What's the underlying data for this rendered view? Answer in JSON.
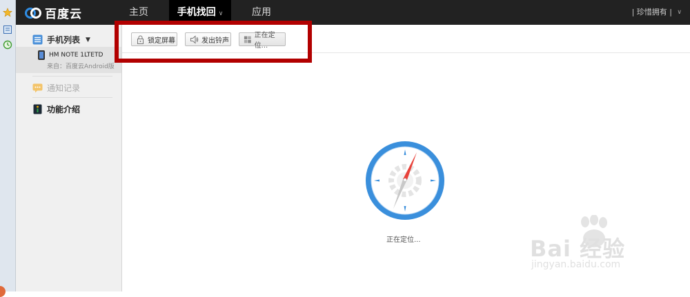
{
  "app": {
    "brand": "百度云"
  },
  "nav": {
    "home": "主页",
    "find_phone": "手机找回",
    "apps": "应用"
  },
  "user": {
    "name": "| 珍惜拥有 |"
  },
  "sidebar": {
    "phone_list": "手机列表",
    "device": {
      "name": "HM NOTE 1LTETD",
      "source": "来自：百度云Android版"
    },
    "notify_log": "通知记录",
    "feature_intro": "功能介绍"
  },
  "toolbar": {
    "lock": "锁定屏幕",
    "ring": "发出铃声",
    "locating": "正在定位..."
  },
  "main": {
    "status": "正在定位..."
  },
  "watermark": {
    "brand": "Bai  经验",
    "url": "jingyan.baidu.com"
  },
  "colors": {
    "accent_red": "#b20000",
    "compass_blue": "#3a8fdc",
    "needle_red": "#e8423a"
  }
}
